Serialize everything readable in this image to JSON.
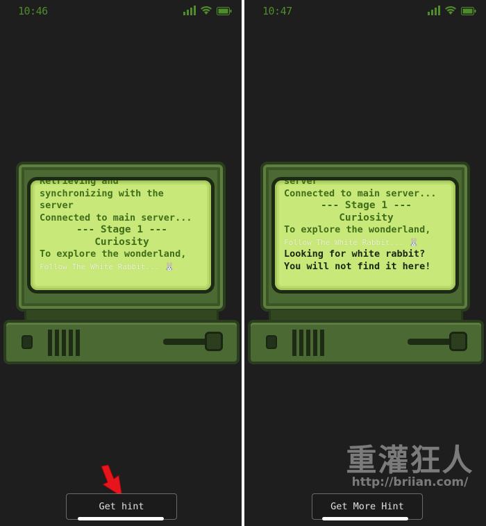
{
  "colors": {
    "phone_bg": "#1e1e1e",
    "status_green": "#4f8c2c",
    "screen_bg": "#c9e87a",
    "screen_text": "#3f6e1a",
    "arrow": "#e8141b"
  },
  "icons": [
    "cellular-signal-icon",
    "wifi-icon",
    "battery-icon",
    "red-arrow-icon",
    "rabbit-emoji-icon"
  ],
  "left_screen": {
    "status_time": "10:46",
    "terminal": {
      "line_partial": "Retrieving and",
      "line_1": "synchronizing with the",
      "line_2": "server",
      "line_3": "Connected to main server...",
      "stage": "--- Stage 1 ---",
      "title": "Curiosity",
      "line_4": "To explore the wonderland,",
      "faint_line": "Follow The White Rabbit...",
      "emoji": "🐰"
    },
    "button_label": "Get hint"
  },
  "right_screen": {
    "status_time": "10:47",
    "terminal": {
      "line_partial": "server",
      "line_1": "Connected to main server...",
      "stage": "--- Stage 1 ---",
      "title": "Curiosity",
      "line_2": "To explore the wonderland,",
      "faint_line": "Follow The White Rabbit...",
      "emoji": "🐰",
      "dark_line_1": "Looking for white rabbit?",
      "dark_line_2": "You will not find it here!"
    },
    "button_label": "Get More Hint"
  },
  "watermark": {
    "text": "重灌狂人",
    "url": "http://briian.com/"
  }
}
